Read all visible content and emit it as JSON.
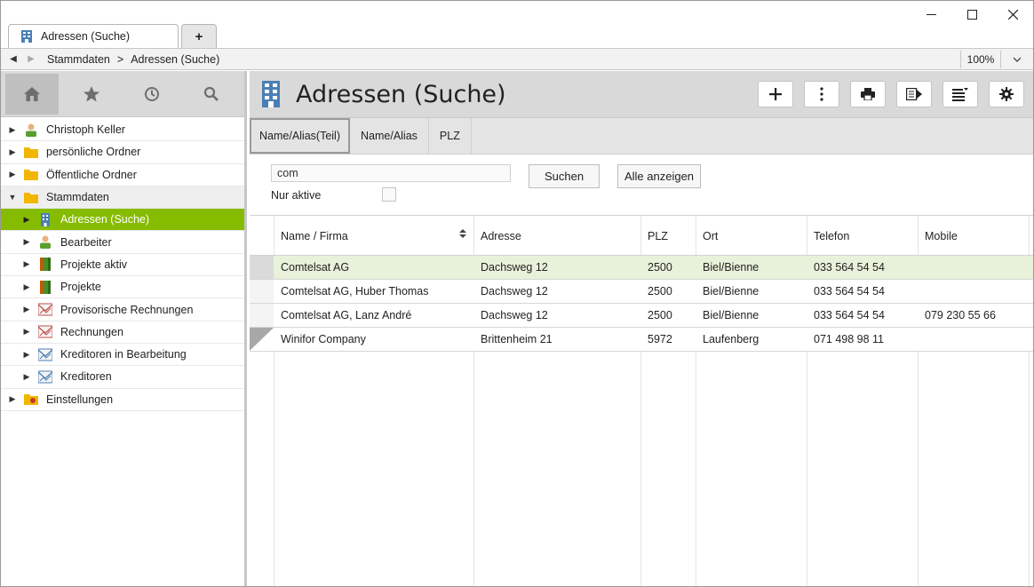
{
  "window": {
    "tab_title": "Adressen (Suche)",
    "add_tab_label": "+",
    "controls": {
      "minimize": "—",
      "maximize": "☐",
      "close": "✕"
    }
  },
  "breadcrumb": {
    "back": "◀",
    "forward": "▶",
    "items": [
      "Stammdaten",
      ">",
      "Adressen (Suche)"
    ],
    "zoom": "100%",
    "zoom_dropdown": "⌄"
  },
  "sidebar": {
    "tools": [
      {
        "name": "home-icon",
        "glyph": "⌂"
      },
      {
        "name": "star-icon",
        "glyph": "★"
      },
      {
        "name": "clock-icon",
        "glyph": "◷"
      },
      {
        "name": "search-icon",
        "glyph": "⚲"
      }
    ],
    "tree": [
      {
        "label": "Christoph Keller",
        "icon": "person-icon",
        "level": 0,
        "twisty": "▶"
      },
      {
        "label": "persönliche Ordner",
        "icon": "folder-icon",
        "level": 0,
        "twisty": "▶"
      },
      {
        "label": "Öffentliche Ordner",
        "icon": "folder-icon",
        "level": 0,
        "twisty": "▶"
      },
      {
        "label": "Stammdaten",
        "icon": "folder-icon",
        "level": 0,
        "twisty": "▼"
      },
      {
        "label": "Adressen (Suche)",
        "icon": "building-icon",
        "level": 1,
        "twisty": "▶"
      },
      {
        "label": "Bearbeiter",
        "icon": "person-icon",
        "level": 1,
        "twisty": "▶"
      },
      {
        "label": "Projekte aktiv",
        "icon": "book-icon",
        "level": 1,
        "twisty": "▶"
      },
      {
        "label": "Projekte",
        "icon": "book-icon",
        "level": 1,
        "twisty": "▶"
      },
      {
        "label": "Provisorische Rechnungen",
        "icon": "invoice-icon",
        "level": 1,
        "twisty": "▶"
      },
      {
        "label": "Rechnungen",
        "icon": "invoice-icon",
        "level": 1,
        "twisty": "▶"
      },
      {
        "label": "Kreditoren in Bearbeitung",
        "icon": "creditor-icon",
        "level": 1,
        "twisty": "▶"
      },
      {
        "label": "Kreditoren",
        "icon": "creditor-icon",
        "level": 1,
        "twisty": "▶"
      },
      {
        "label": "Einstellungen",
        "icon": "settings-folder-icon",
        "level": 0,
        "twisty": "▶"
      }
    ]
  },
  "main": {
    "title": "Adressen (Suche)",
    "toolbar": [
      {
        "name": "add-button",
        "glyph": "+"
      },
      {
        "name": "more-button",
        "glyph": "⋮"
      },
      {
        "name": "print-button",
        "glyph": "⎙"
      },
      {
        "name": "export-button",
        "glyph": "▤"
      },
      {
        "name": "list-options-button",
        "glyph": "≡"
      },
      {
        "name": "settings-button",
        "glyph": "⚙"
      }
    ],
    "search_tabs": [
      "Name/Alias(Teil)",
      "Name/Alias",
      "PLZ"
    ],
    "search": {
      "value": "com",
      "only_active_label": "Nur aktive",
      "search_button": "Suchen",
      "show_all_button": "Alle anzeigen"
    },
    "table": {
      "sort_glyph": "▲▼",
      "columns": [
        "Name / Firma",
        "Adresse",
        "PLZ",
        "Ort",
        "Telefon",
        "Mobile"
      ],
      "rows": [
        [
          "Comtelsat AG",
          "Dachsweg 12",
          "2500",
          "Biel/Bienne",
          "033 564 54 54",
          ""
        ],
        [
          "Comtelsat AG, Huber Thomas",
          "Dachsweg 12",
          "2500",
          "Biel/Bienne",
          "033 564 54 54",
          ""
        ],
        [
          "Comtelsat AG, Lanz André",
          "Dachsweg 12",
          "2500",
          "Biel/Bienne",
          "033 564 54 54",
          "079 230 55 66"
        ],
        [
          "Winifor Company",
          "Brittenheim 21",
          "5972",
          "Laufenberg",
          "071 498 98 11",
          ""
        ]
      ]
    }
  },
  "colors": {
    "selection_green": "#86bc00",
    "row_highlight": "#e8f1d9",
    "header_grey": "#d9d9d9",
    "building_blue": "#4a7fb5",
    "folder_yellow": "#f3b600"
  }
}
